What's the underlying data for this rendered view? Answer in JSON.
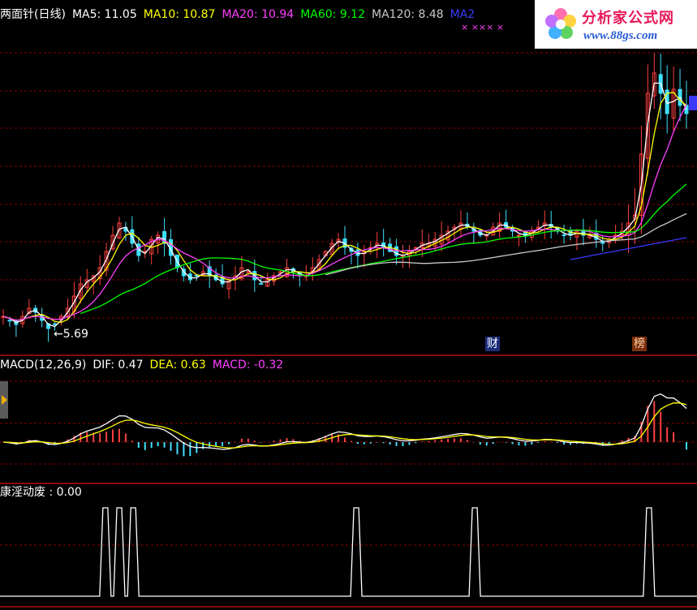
{
  "main_header": {
    "name": "两面针(日线)",
    "ma5": "MA5: 11.05",
    "ma10": "MA10: 10.87",
    "ma20": "MA20: 10.94",
    "ma60": "MA60: 9.12",
    "ma120": "MA120: 8.48",
    "ma250_partial": "MA2"
  },
  "macd_header": {
    "name": "MACD(12,26,9)",
    "dif": "DIF: 0.47",
    "dea": "DEA: 0.63",
    "macd": "MACD: -0.32"
  },
  "indicator_header": {
    "text": "康淫动废 : 0.00"
  },
  "annotations": {
    "low_price": "5.69",
    "tag_cai": "财",
    "tag_bang": "榜",
    "xmarks": "× ××× ×"
  },
  "logo": {
    "cn": "分析家公式网",
    "url": "www.88gs.com"
  },
  "colors": {
    "ma5": "#ffffff",
    "ma10": "#ffff00",
    "ma20": "#ff40ff",
    "ma60": "#00ff00",
    "ma120": "#c8c8c8",
    "ma250": "#3a3aff",
    "up": "#ff4040",
    "down": "#40e0ff",
    "grid": "#8b0000",
    "border": "#b01010"
  },
  "chart_data": [
    {
      "type": "candlestick",
      "title": "两面针(日线)",
      "ylim": [
        5.2,
        13.0
      ],
      "x_count": 170,
      "annotation_low": 5.69,
      "price_path": [
        6.0,
        5.9,
        5.8,
        6.0,
        6.2,
        6.1,
        5.9,
        5.7,
        5.8,
        6.0,
        6.2,
        6.5,
        6.8,
        6.9,
        7.0,
        7.2,
        7.6,
        8.0,
        8.3,
        8.1,
        7.8,
        7.5,
        7.6,
        7.9,
        8.0,
        7.8,
        7.5,
        7.2,
        7.0,
        6.9,
        7.0,
        7.1,
        7.0,
        6.9,
        6.8,
        6.9,
        7.0,
        7.2,
        7.1,
        6.9,
        6.8,
        6.9,
        7.0,
        7.1,
        7.2,
        7.1,
        7.0,
        7.0,
        7.2,
        7.4,
        7.6,
        7.8,
        7.9,
        7.7,
        7.6,
        7.5,
        7.6,
        7.7,
        7.8,
        7.7,
        7.6,
        7.5,
        7.5,
        7.6,
        7.7,
        7.8,
        7.8,
        7.9,
        8.0,
        8.1,
        8.2,
        8.3,
        8.2,
        8.1,
        8.0,
        8.0,
        8.2,
        8.3,
        8.2,
        8.1,
        8.0,
        8.0,
        8.1,
        8.2,
        8.3,
        8.2,
        8.1,
        8.0,
        8.0,
        8.1,
        8.0,
        8.0,
        7.9,
        7.8,
        7.9,
        8.0,
        8.1,
        8.3,
        8.5,
        10.0,
        11.5,
        12.0,
        11.5,
        11.0,
        11.6,
        11.2,
        11.0
      ]
    },
    {
      "type": "line",
      "title": "MACD(12,26,9)",
      "series": [
        {
          "name": "DIF",
          "value": 0.47
        },
        {
          "name": "DEA",
          "value": 0.63
        },
        {
          "name": "MACD",
          "value": -0.32
        }
      ],
      "ylim": [
        -0.8,
        1.6
      ]
    },
    {
      "type": "line",
      "title": "康淫动废",
      "value": 0.0,
      "pulse_positions": [
        0.15,
        0.17,
        0.19,
        0.51,
        0.68,
        0.93
      ],
      "ylim": [
        0,
        1
      ]
    }
  ]
}
